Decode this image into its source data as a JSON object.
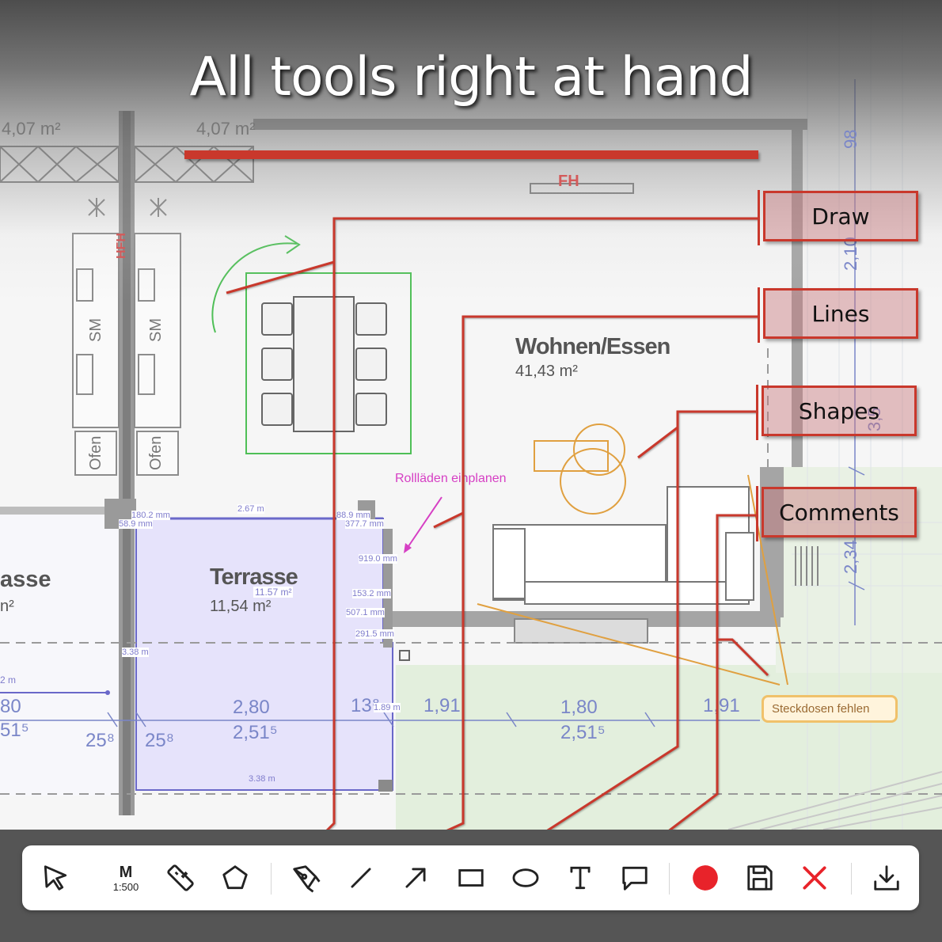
{
  "headline": "All tools right at hand",
  "callouts": {
    "draw": "Draw",
    "lines": "Lines",
    "shapes": "Shapes",
    "comments": "Comments"
  },
  "plan_labels": {
    "area_top_left": "4,07 m²",
    "area_top_mid": "4,07 m²",
    "fh": "FH",
    "hfh": "HFH",
    "sm1": "SM",
    "sm2": "SM",
    "ofen1": "Ofen",
    "ofen2": "Ofen",
    "room_name": "Wohnen/Essen",
    "room_area": "41,43 m²",
    "terrace_name": "Terrasse",
    "terrace_area": "11,54 m²",
    "terrace_area_measured": "11.57 m²",
    "left_room_name": "asse",
    "left_room_area": "n²",
    "note_pink": "Rollläden einplanen",
    "comment_box": "Steckdosen fehlen",
    "dim_top_right": "98",
    "dim_right_1": "2,10",
    "dim_right_2": "2,34",
    "dim_right_3": "3,5",
    "dim_row": [
      {
        "top": "80",
        "bottom": "51⁵"
      },
      {
        "top": "25⁸",
        "bottom": ""
      },
      {
        "top": "25⁸",
        "bottom": ""
      },
      {
        "top": "2,80",
        "bottom": "2,51⁵"
      },
      {
        "top": "13⁸",
        "bottom": ""
      },
      {
        "top": "1,91",
        "bottom": ""
      },
      {
        "top": "1,80",
        "bottom": "2,51⁵"
      },
      {
        "top": "1,91",
        "bottom": ""
      }
    ],
    "measurements": [
      "180.2 mm",
      "58.9 mm",
      "2.67 m",
      "88.9 mm",
      "377.7 mm",
      "919.0 mm",
      "153.2 mm",
      "507.1 mm",
      "291.5 mm",
      "3.38 m",
      "1.89 m",
      "3.38 m",
      "2 m"
    ]
  },
  "toolbar": {
    "scale_label": "M",
    "scale_value": "1:500",
    "tools": [
      {
        "id": "select",
        "icon": "cursor-icon"
      },
      {
        "id": "scale",
        "icon": "scale-icon"
      },
      {
        "id": "measure",
        "icon": "ruler-icon"
      },
      {
        "id": "area",
        "icon": "pentagon-icon"
      },
      {
        "id": "draw",
        "icon": "pen-icon"
      },
      {
        "id": "line",
        "icon": "line-icon"
      },
      {
        "id": "arrow",
        "icon": "arrow-icon"
      },
      {
        "id": "rectangle",
        "icon": "rectangle-icon"
      },
      {
        "id": "ellipse",
        "icon": "ellipse-icon"
      },
      {
        "id": "text",
        "icon": "text-icon"
      },
      {
        "id": "comment",
        "icon": "comment-icon"
      },
      {
        "id": "color",
        "icon": "color-dot-icon"
      },
      {
        "id": "save",
        "icon": "save-icon"
      },
      {
        "id": "close",
        "icon": "close-icon"
      },
      {
        "id": "download",
        "icon": "download-icon"
      }
    ]
  },
  "colors": {
    "accent_red": "#c9382c",
    "color_dot": "#e8232a",
    "note_pink": "#d63fc4",
    "comment_orange": "#e0a040",
    "terrace_fill": "#e6e3fb",
    "measure_blue": "#6a68c9"
  }
}
